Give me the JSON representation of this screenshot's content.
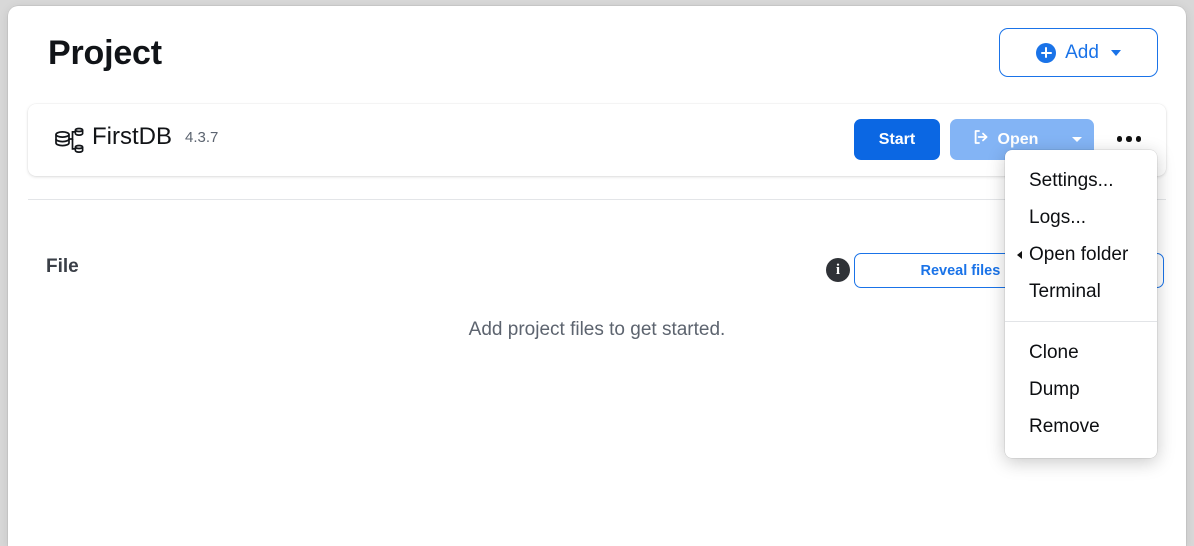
{
  "header": {
    "title": "Project",
    "add_button": {
      "label": "Add",
      "icon": "plus-circle-icon",
      "caret": "chevron-down-icon",
      "accent_color": "#1a73e8"
    }
  },
  "project_card": {
    "icon": "database-cluster-icon",
    "name": "FirstDB",
    "version": "4.3.7",
    "start_button": {
      "label": "Start",
      "background_color": "#0b67e3",
      "text_color": "#ffffff"
    },
    "open_button": {
      "label": "Open",
      "icon": "external-link-icon",
      "caret": "chevron-down-icon",
      "background_color": "#83b4f5",
      "text_color": "#ffffff"
    },
    "more_button": {
      "icon": "ellipsis-icon"
    }
  },
  "file_section": {
    "label": "File",
    "info_icon": "info-icon",
    "info_glyph": "i",
    "reveal_button": {
      "label": "Reveal files in Finder",
      "caret": "chevron-down-icon",
      "accent_color": "#1a73e8"
    },
    "empty_message": "Add project files to get started."
  },
  "context_menu": {
    "groups": [
      {
        "items": [
          {
            "label": "Settings...",
            "has_submenu": false
          },
          {
            "label": "Logs...",
            "has_submenu": false
          },
          {
            "label": "Open folder",
            "has_submenu": true
          },
          {
            "label": "Terminal",
            "has_submenu": false
          }
        ]
      },
      {
        "items": [
          {
            "label": "Clone",
            "has_submenu": false
          },
          {
            "label": "Dump",
            "has_submenu": false
          },
          {
            "label": "Remove",
            "has_submenu": false
          }
        ]
      }
    ]
  }
}
